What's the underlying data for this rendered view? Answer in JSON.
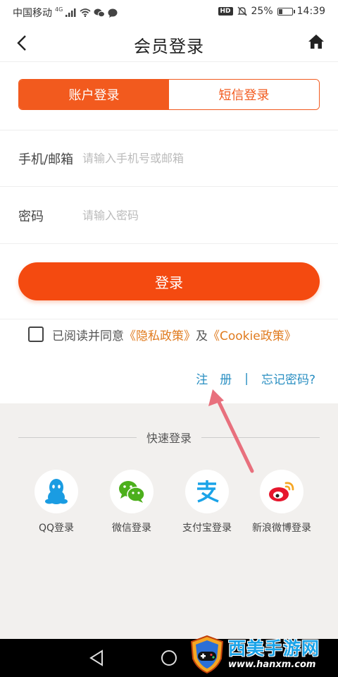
{
  "status_bar": {
    "carrier": "中国移动",
    "network": "4G",
    "battery": "25%",
    "time": "14:39",
    "hd": "HD"
  },
  "header": {
    "title": "会员登录"
  },
  "tabs": [
    {
      "label": "账户登录",
      "active": true
    },
    {
      "label": "短信登录",
      "active": false
    }
  ],
  "form": {
    "account": {
      "label": "手机/邮箱",
      "placeholder": "请输入手机号或邮箱",
      "value": ""
    },
    "password": {
      "label": "密码",
      "placeholder": "请输入密码",
      "value": ""
    }
  },
  "login_button": "登录",
  "agreement": {
    "prefix": "已阅读并同意",
    "privacy": "《隐私政策》",
    "and": "及",
    "cookie": "《Cookie政策》",
    "checked": false
  },
  "links": {
    "register": "注　册",
    "separator": "|",
    "forgot": "忘记密码?"
  },
  "quick_login": {
    "title": "快速登录",
    "items": [
      {
        "label": "QQ登录",
        "icon": "qq-icon"
      },
      {
        "label": "微信登录",
        "icon": "wechat-icon"
      },
      {
        "label": "支付宝登录",
        "icon": "alipay-icon"
      },
      {
        "label": "新浪微博登录",
        "icon": "weibo-icon"
      }
    ]
  },
  "watermark": {
    "title": "西美手游网",
    "url": "www.hanxm.com"
  },
  "colors": {
    "accent": "#f25a1e",
    "link": "#2a8fc2",
    "policy": "#e07b1f",
    "quick_bg": "#f2f0ee"
  }
}
